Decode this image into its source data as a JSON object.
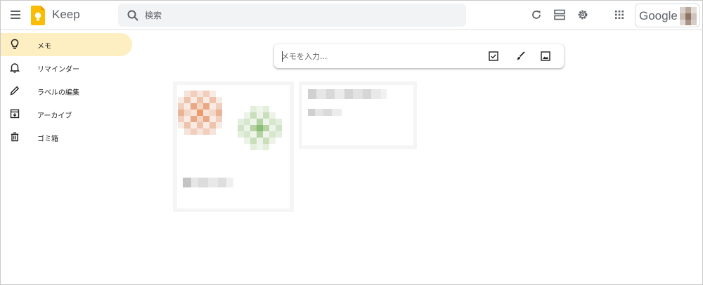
{
  "header": {
    "app_title": "Keep",
    "search_placeholder": "検索",
    "account_text": "Google",
    "icons": [
      "menu-icon",
      "keep-logo",
      "search-icon",
      "refresh-icon",
      "list-view-icon",
      "settings-icon",
      "apps-grid-icon"
    ]
  },
  "sidebar": {
    "items": [
      {
        "label": "メモ",
        "icon": "lightbulb-icon",
        "active": true
      },
      {
        "label": "リマインダー",
        "icon": "bell-icon",
        "active": false
      },
      {
        "label": "ラベルの編集",
        "icon": "pencil-icon",
        "active": false
      },
      {
        "label": "アーカイブ",
        "icon": "archive-icon",
        "active": false
      },
      {
        "label": "ゴミ箱",
        "icon": "trash-icon",
        "active": false
      }
    ]
  },
  "take_note": {
    "placeholder": "メモを入力...",
    "icons": [
      "checkbox-icon",
      "brush-icon",
      "image-icon"
    ]
  },
  "colors": {
    "active_nav_bg": "#feefc3",
    "logo_yellow": "#fbbc04",
    "icon_gray": "#5f6368",
    "search_bg": "#f1f3f4"
  }
}
